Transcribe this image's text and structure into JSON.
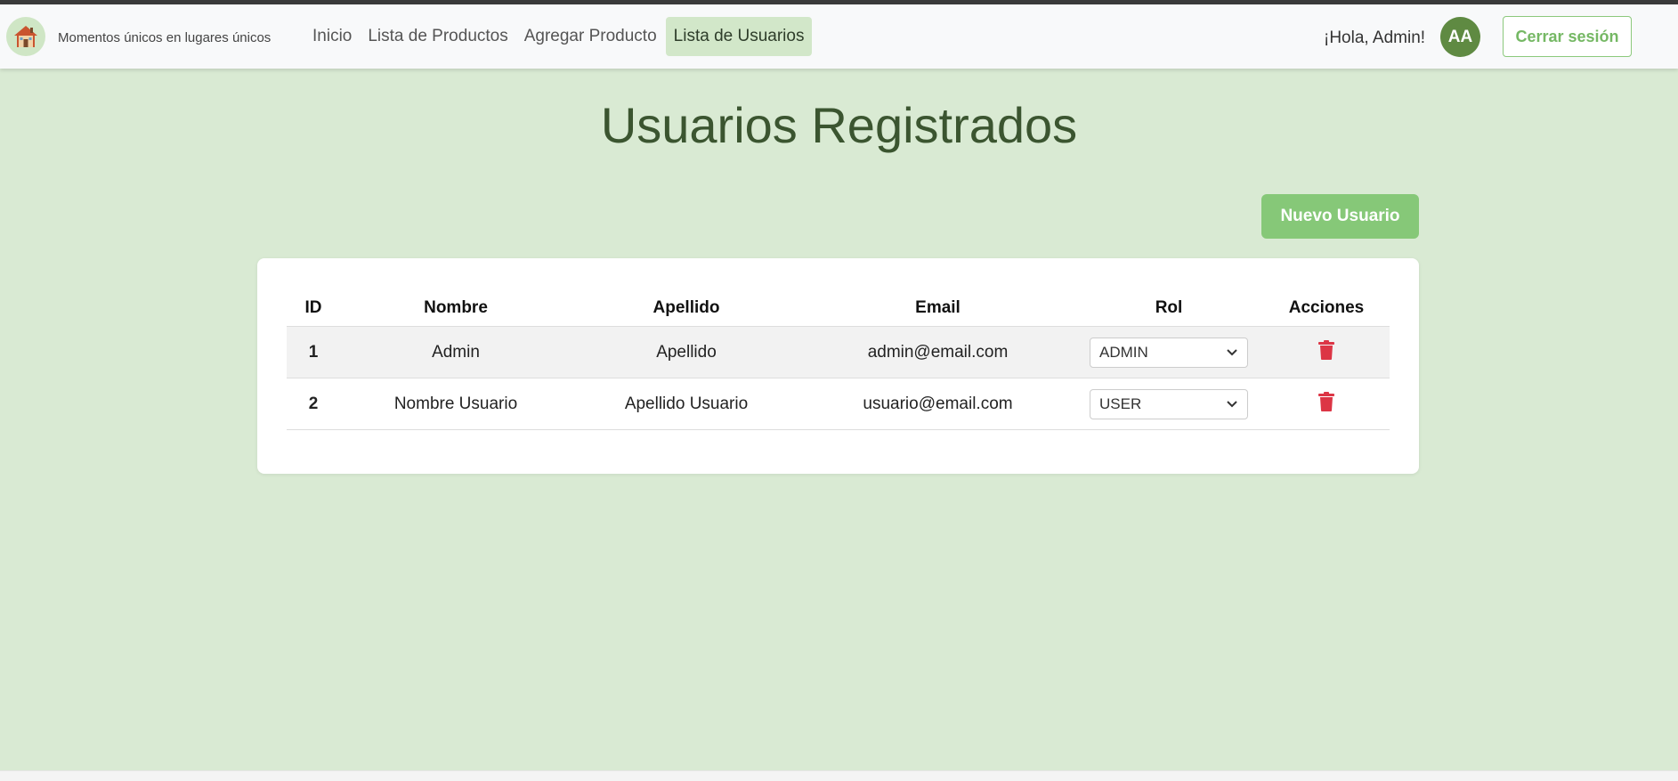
{
  "header": {
    "slogan": "Momentos únicos en lugares únicos",
    "logo_icon": "house-icon",
    "nav": [
      {
        "label": "Inicio"
      },
      {
        "label": "Lista de Productos"
      },
      {
        "label": "Agregar Producto"
      },
      {
        "label": "Lista de Usuarios",
        "active": true
      }
    ],
    "greeting": "¡Hola, Admin!",
    "avatar_initials": "AA",
    "logout_label": "Cerrar sesión"
  },
  "main": {
    "title": "Usuarios Registrados",
    "new_user_label": "Nuevo Usuario",
    "table": {
      "columns": [
        "ID",
        "Nombre",
        "Apellido",
        "Email",
        "Rol",
        "Acciones"
      ],
      "rows": [
        {
          "id": "1",
          "nombre": "Admin",
          "apellido": "Apellido",
          "email": "admin@email.com",
          "rol": "ADMIN",
          "action_icon": "trash-icon"
        },
        {
          "id": "2",
          "nombre": "Nombre Usuario",
          "apellido": "Apellido Usuario",
          "email": "usuario@email.com",
          "rol": "USER",
          "action_icon": "trash-icon"
        }
      ]
    }
  },
  "colors": {
    "background": "#d9ead3",
    "accent": "#86c878",
    "title": "#3b5530",
    "avatar": "#5f8a42",
    "delete": "#dc3545"
  }
}
